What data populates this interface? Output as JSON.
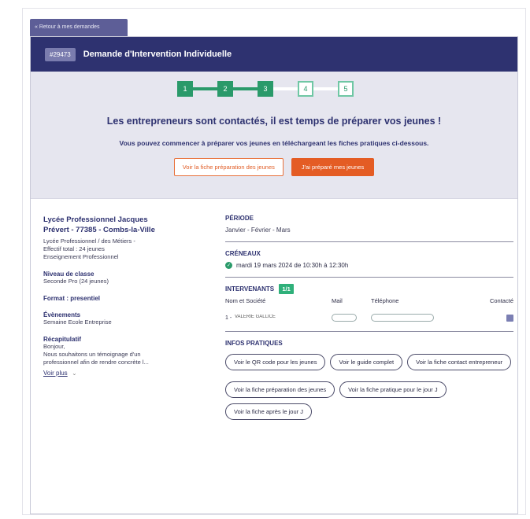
{
  "back_link": "« Retour à mes demandes",
  "header": {
    "id": "#29473",
    "title": "Demande d'Intervention Individuelle"
  },
  "stepper": {
    "steps": [
      "1",
      "2",
      "3",
      "4",
      "5"
    ],
    "completed": 3
  },
  "hero": {
    "title": "Les entrepreneurs sont contactés, il est temps de préparer vos jeunes !",
    "subtitle": "Vous pouvez commencer à préparer vos jeunes en téléchargeant les fiches pratiques ci-dessous.",
    "btn_fiche": "Voir la fiche préparation des jeunes",
    "btn_prepare": "J'ai préparé mes jeunes"
  },
  "left": {
    "school_line1": "Lycée Professionnel Jacques",
    "school_line2": "Prévert - 77385 - Combs-la-Ville",
    "type_line1": "Lycée Professionnel / des Métiers -",
    "type_line2": "Effectif total : 24 jeunes",
    "type_line3": "Enseignement Professionnel",
    "niveau_label": "Niveau de classe",
    "niveau_val": "Seconde Pro (24 jeunes)",
    "format": "Format : presentiel",
    "evenements_label": "Évènements",
    "evenements_val": "Semaine Ecole Entreprise",
    "recap_label": "Récapitulatif",
    "recap_l1": "Bonjour,",
    "recap_l2": "Nous souhaitons un témoignage d'un",
    "recap_l3": "professionnel afin de rendre concrète l...",
    "voir_plus": "Voir plus"
  },
  "right": {
    "periode_label": "PÉRIODE",
    "periode_val": "Janvier - Février - Mars",
    "creneaux_label": "CRÉNEAUX",
    "creneau_val": "mardi 19 mars 2024 de 10:30h à 12:30h",
    "intervenants_label": "INTERVENANTS",
    "intervenants_badge": "1/1",
    "col_nom": "Nom et Société",
    "col_mail": "Mail",
    "col_tel": "Téléphone",
    "col_contacte": "Contacté",
    "row_index": "1 -",
    "row_name": "VALERIE GALLICE",
    "infos_label": "INFOS PRATIQUES",
    "links": [
      "Voir le QR code pour les jeunes",
      "Voir le guide complet",
      "Voir la fiche contact entrepreneur",
      "Voir la fiche préparation des jeunes",
      "Voir la fiche pratique pour le jour J",
      "Voir la fiche après le jour J"
    ]
  },
  "colors": {
    "navy": "#2e3270",
    "green": "#2a9a6a",
    "orange": "#e45c24"
  }
}
